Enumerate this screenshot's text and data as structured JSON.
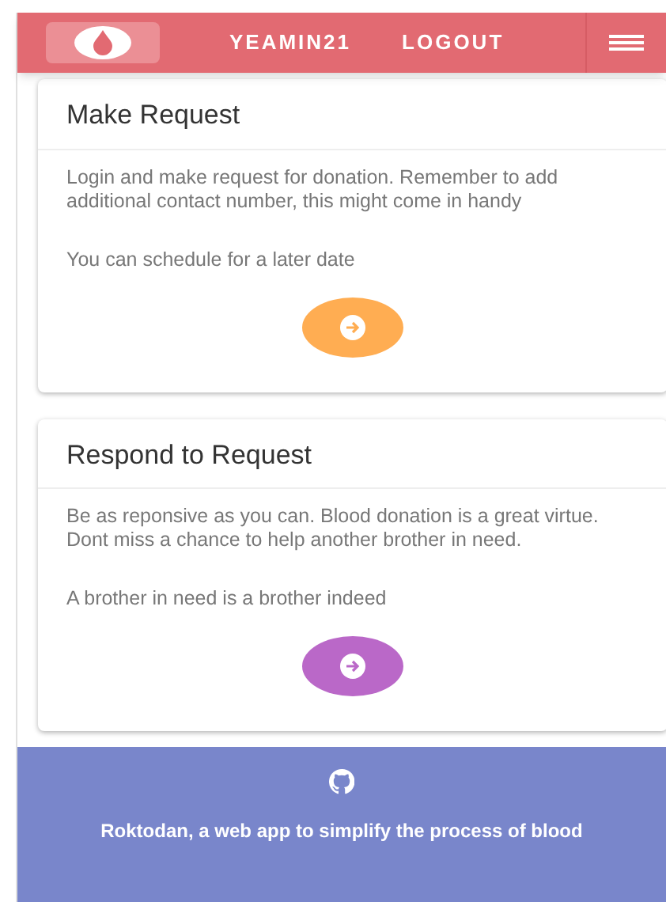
{
  "navbar": {
    "username": "YEAMIN21",
    "logout": "LOGOUT"
  },
  "cards": [
    {
      "title": "Make Request",
      "paragraphs": [
        "Login and make request for donation. Remember to add additional contact number, this might come in handy",
        "You can schedule for a later date"
      ],
      "color": "#ffad52"
    },
    {
      "title": "Respond to Request",
      "paragraphs": [
        "Be as reponsive as you can. Blood donation is a great virtue. Dont miss a chance to help another brother in need.",
        "A brother in need is a brother indeed"
      ],
      "color": "#ba68c8"
    }
  ],
  "footer": {
    "text": "Roktodan, a web app to simplify the process of blood"
  }
}
